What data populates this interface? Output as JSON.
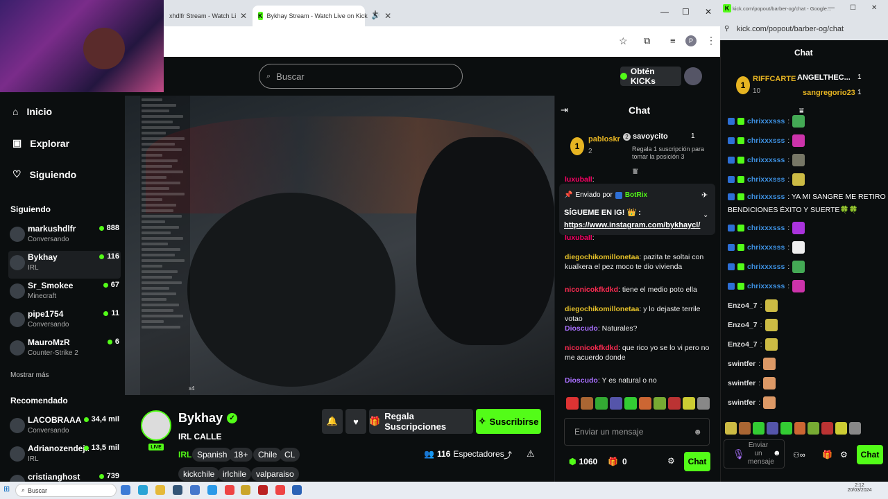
{
  "browser": {
    "tabs": [
      {
        "title": "xhdlfr Stream - Watch Live on Kick"
      },
      {
        "title": "Bykhay Stream - Watch Live on Kick"
      }
    ],
    "new_tab": "+",
    "minimize": "—",
    "maximize": "☐",
    "close": "✕"
  },
  "popout_browser": {
    "tab_title": "kick.com/popout/barber-og/chat - Google...",
    "url": "kick.com/popout/barber-og/chat"
  },
  "header": {
    "search_placeholder": "Buscar",
    "get_kicks_label": "Obtén KICKs"
  },
  "nav": {
    "home": "Inicio",
    "explore": "Explorar",
    "following": "Siguiendo",
    "following_section": "Siguiendo",
    "show_more": "Mostrar más",
    "recommended_section": "Recomendado",
    "following_channels": [
      {
        "name": "markushdlfr",
        "category": "Conversando",
        "viewers": "888"
      },
      {
        "name": "Bykhay",
        "category": "IRL",
        "viewers": "116"
      },
      {
        "name": "Sr_Smokee",
        "category": "Minecraft",
        "viewers": "67"
      },
      {
        "name": "pipe1754",
        "category": "Conversando",
        "viewers": "11"
      },
      {
        "name": "MauroMzR",
        "category": "Counter-Strike 2",
        "viewers": "6"
      }
    ],
    "recommended_channels": [
      {
        "name": "LACOBRAAA",
        "category": "Conversando",
        "viewers": "34,4 mil"
      },
      {
        "name": "Adrianozendej...",
        "category": "IRL",
        "viewers": "13,5 mil"
      },
      {
        "name": "cristianghost",
        "category": "",
        "viewers": "739"
      }
    ]
  },
  "stream": {
    "streamer": "Bykhay",
    "title": "IRL CALLE",
    "category": "IRL",
    "live_badge": "LIVE",
    "tags": [
      "Spanish",
      "18+",
      "Chile",
      "CL"
    ],
    "tags2": [
      "kickchile",
      "irlchile",
      "valparaiso"
    ],
    "viewers": "116",
    "viewers_label": "Espectadores",
    "gift_subs_label": "Regala Suscripciones",
    "subscribe_label": "Suscribirse",
    "overlay_counter": "x4"
  },
  "chat": {
    "title": "Chat",
    "leaderboard": {
      "first": {
        "rank": "1",
        "name": "pabloskr",
        "count": "2"
      },
      "second": {
        "rank": "2",
        "name": "savoycito",
        "count": "1"
      },
      "promo": "Regala 1 suscripción para tomar la posición 3"
    },
    "pinned": {
      "sent_by": "Enviado por",
      "bot": "BotRix",
      "text": "SÍGUEME EN IG! 👑 :",
      "link": "https://www.instagram.com/bykhaycl/"
    },
    "messages": [
      {
        "user": "luxuball",
        "text": ":",
        "color": "#f06"
      },
      {
        "user": "luxuball",
        "text": ":",
        "color": "#f06"
      },
      {
        "user": "diegochikomillonetaa",
        "text": ": pazita te soltai con kualkera el pez moco te dio vivienda",
        "color": "#e6c229"
      },
      {
        "user": "niconicokfkdkd",
        "text": ": tiene el medio poto ella",
        "color": "#ff2b52"
      },
      {
        "user": "diegochikomillonetaa",
        "text": ": y lo dejaste terrile votao",
        "color": "#e6c229"
      },
      {
        "user": "Dioscudo",
        "text": ": Naturales?",
        "color": "#a970ff"
      },
      {
        "user": "niconicokfkdkd",
        "text": ": que rico yo se lo vi pero no me acuerdo donde",
        "color": "#ff2b52"
      },
      {
        "user": "Dioscudo",
        "text": ": Y es natural o no",
        "color": "#a970ff"
      }
    ],
    "input_placeholder": "Enviar un mensaje",
    "kicks_count": "1060",
    "gift_count": "0",
    "send_label": "Chat"
  },
  "popout_chat": {
    "title": "Chat",
    "leaderboard": {
      "first": {
        "rank": "1",
        "name": "RIFFCARTE",
        "count": "10"
      },
      "second": {
        "name": "ANGELTHEC...",
        "count": "1"
      },
      "third": {
        "name": "sangregorio23",
        "count": "1"
      }
    },
    "messages": [
      {
        "user": "chrixxxsss",
        "text": ":"
      },
      {
        "user": "chrixxxsss",
        "text": ":"
      },
      {
        "user": "chrixxxsss",
        "text": ":"
      },
      {
        "user": "chrixxxsss",
        "text": ":"
      },
      {
        "user": "chrixxxsss",
        "text": ": YA MI SANGRE ME RETIRO"
      },
      {
        "user": "",
        "text": "BENDICIONES ÉXITO Y SUERTE🍀🍀"
      },
      {
        "user": "chrixxxsss",
        "text": ":"
      },
      {
        "user": "chrixxxsss",
        "text": ":"
      },
      {
        "user": "chrixxxsss",
        "text": ":"
      },
      {
        "user": "chrixxxsss",
        "text": ":"
      },
      {
        "user": "Enzo4_7",
        "text": ":"
      },
      {
        "user": "Enzo4_7",
        "text": ":"
      },
      {
        "user": "Enzo4_7",
        "text": ":"
      },
      {
        "user": "swintfer",
        "text": ":"
      },
      {
        "user": "swintfer",
        "text": ":"
      },
      {
        "user": "swintfer",
        "text": ":"
      }
    ],
    "input_placeholder": "Enviar un mensaje",
    "send_label": "Chat"
  },
  "taskbar": {
    "search": "Buscar",
    "time": "2:12",
    "date": "20/03/2024"
  },
  "colors": {
    "kick_green": "#53fc18",
    "background": "#0b0e0f"
  }
}
